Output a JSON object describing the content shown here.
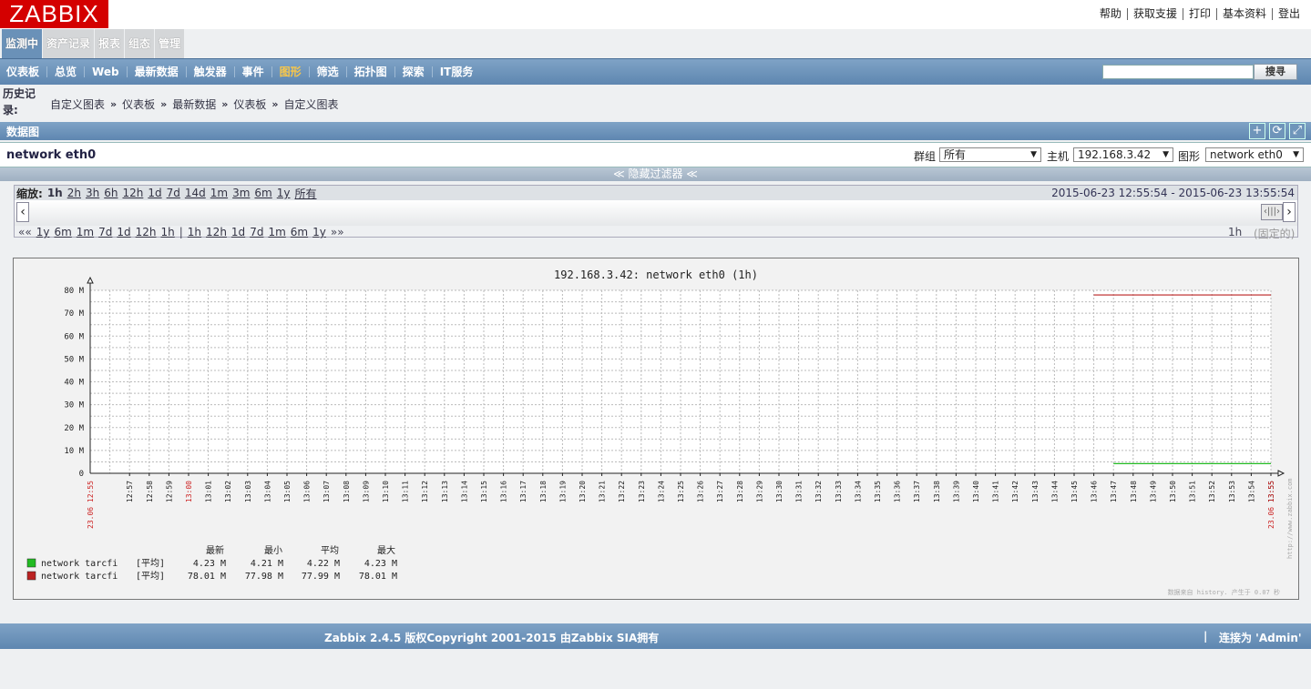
{
  "header": {
    "logo": "ZABBIX",
    "links": [
      "帮助",
      "获取支援",
      "打印",
      "基本资料",
      "登出"
    ]
  },
  "main_tabs": [
    "监测中",
    "资产记录",
    "报表",
    "组态",
    "管理"
  ],
  "sub_nav": [
    "仪表板",
    "总览",
    "Web",
    "最新数据",
    "触发器",
    "事件",
    "图形",
    "筛选",
    "拓扑图",
    "探索",
    "IT服务"
  ],
  "search": {
    "button": "搜寻",
    "value": ""
  },
  "history": {
    "label": "历史记录:",
    "items": [
      "自定义图表",
      "仪表板",
      "最新数据",
      "仪表板",
      "自定义图表"
    ],
    "sep": "»"
  },
  "panel": {
    "title": "数据图",
    "graph_name": "network eth0",
    "filters": {
      "group_label": "群组",
      "group_value": "所有",
      "host_label": "主机",
      "host_value": "192.168.3.42",
      "graph_label": "图形",
      "graph_value": "network eth0"
    },
    "hide_filter": "≪ 隐藏过滤器 ≪"
  },
  "scroll": {
    "zoom_label": "缩放:",
    "zoom": [
      "1h",
      "2h",
      "3h",
      "6h",
      "12h",
      "1d",
      "7d",
      "14d",
      "1m",
      "3m",
      "6m",
      "1y",
      "所有"
    ],
    "date_from": "2015-06-23 12:55:54",
    "date_sep": "-",
    "date_to": "2015-06-23 13:55:54",
    "nav_back": "««",
    "back": [
      "1y",
      "6m",
      "1m",
      "7d",
      "1d",
      "12h",
      "1h"
    ],
    "pipe": "|",
    "fwd": [
      "1h",
      "12h",
      "1d",
      "7d",
      "1m",
      "6m",
      "1y"
    ],
    "nav_fwd": "»»",
    "period": "1h",
    "fixed": "(固定的)"
  },
  "chart_data": {
    "type": "line",
    "title": "192.168.3.42: network eth0 (1h)",
    "ylim": [
      0,
      80
    ],
    "yticks": [
      "0",
      "10 M",
      "20 M",
      "30 M",
      "40 M",
      "50 M",
      "60 M",
      "70 M",
      "80 M"
    ],
    "xticks": [
      "12:57",
      "12:58",
      "12:59",
      "13:00",
      "13:01",
      "13:02",
      "13:03",
      "13:04",
      "13:05",
      "13:06",
      "13:07",
      "13:08",
      "13:09",
      "13:10",
      "13:11",
      "13:12",
      "13:13",
      "13:14",
      "13:15",
      "13:16",
      "13:17",
      "13:18",
      "13:19",
      "13:20",
      "13:21",
      "13:22",
      "13:23",
      "13:24",
      "13:25",
      "13:26",
      "13:27",
      "13:28",
      "13:29",
      "13:30",
      "13:31",
      "13:32",
      "13:33",
      "13:34",
      "13:35",
      "13:36",
      "13:37",
      "13:38",
      "13:39",
      "13:40",
      "13:41",
      "13:42",
      "13:43",
      "13:44",
      "13:45",
      "13:46",
      "13:47",
      "13:48",
      "13:49",
      "13:50",
      "13:51",
      "13:52",
      "13:53",
      "13:54",
      "13:55"
    ],
    "x_start_label": "23.06 12:55",
    "x_end_label": "23.06 13:55",
    "x_mid_label": "13:00",
    "legend_headers": [
      "最新",
      "最小",
      "平均",
      "最大"
    ],
    "series": [
      {
        "name": "network tarcfi",
        "agg": "[平均]",
        "color": "#22bb22",
        "last": "4.23 M",
        "min": "4.21 M",
        "avg": "4.22 M",
        "max": "4.23 M",
        "value": 4.22,
        "start_minute": 52
      },
      {
        "name": "network tarcfi",
        "agg": "[平均]",
        "color": "#bb2222",
        "last": "78.01 M",
        "min": "77.98 M",
        "avg": "77.99 M",
        "max": "78.01 M",
        "value": 77.99,
        "start_minute": 51
      }
    ],
    "watermark": "http://www.zabbix.com",
    "footnote": "数据来自 history. 产生于 0.07 秒"
  },
  "footer": {
    "copyright": "Zabbix 2.4.5 版权Copyright 2001-2015 由Zabbix SIA拥有",
    "connected": "连接为 'Admin'",
    "sep": "|"
  }
}
